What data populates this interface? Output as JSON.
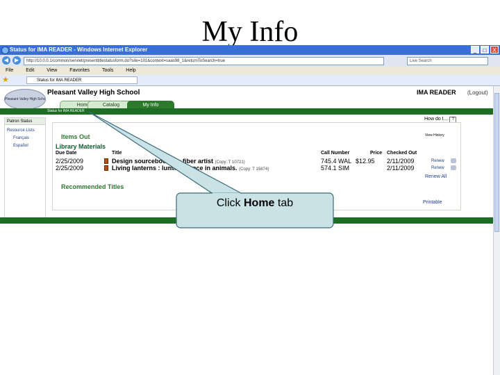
{
  "slide": {
    "title": "My Info"
  },
  "browser": {
    "title": "Status for IMA READER - Windows Internet Explorer",
    "address": "http://10.0.0.1/common/servlet/presenttitlestatusform.do?site=101&context=saas98_1&returnToSearch=true",
    "search_placeholder": "Live Search",
    "menu": [
      "File",
      "Edit",
      "View",
      "Favorites",
      "Tools",
      "Help"
    ],
    "tab_label": "Status for IMA READER",
    "win_min": "_",
    "win_max": "□",
    "win_close": "X",
    "back": "◀",
    "forward": "▶"
  },
  "app": {
    "logo_text": "Pleasant Valley High School",
    "school_name": "Pleasant Valley High School",
    "user_name": "IMA READER",
    "logout": "(Logout)",
    "tabs": [
      "Home",
      "Catalog",
      "My Info"
    ],
    "subnav": "Status for IMA READER"
  },
  "sidebar": {
    "tab": "Patron Status",
    "links": [
      "Resource Lists",
      "Français",
      "Español"
    ]
  },
  "main": {
    "help": "How do I...",
    "help_mark": "?",
    "items_out": "Items Out",
    "library_materials": "Library Materials",
    "view_history": "View History",
    "columns": [
      "Due Date",
      "Title",
      "Call Number",
      "Price",
      "Checked Out"
    ],
    "rows": [
      {
        "due": "2/25/2009",
        "title": "Design sourcebook the fiber artist",
        "copy": "(Copy: T 10721)",
        "call": "745.4 WAL",
        "price": "$12.95",
        "checked": "2/11/2009",
        "renew": "Renew"
      },
      {
        "due": "2/25/2009",
        "title": "Living lanterns : luminescence in animals.",
        "copy": "(Copy: T 15874)",
        "call": "574.1 SIM",
        "price": "",
        "checked": "2/11/2009",
        "renew": "Renew"
      }
    ],
    "renew_all": "Renew All",
    "recommended": "Recommended Titles",
    "printable": "Printable"
  },
  "callout": {
    "prefix": "Click ",
    "bold": "Home",
    "suffix": " tab"
  },
  "colors": {
    "accent_green": "#1d6e24",
    "callout_fill": "#c8e2e6",
    "ie_blue": "#3a6fd8"
  }
}
